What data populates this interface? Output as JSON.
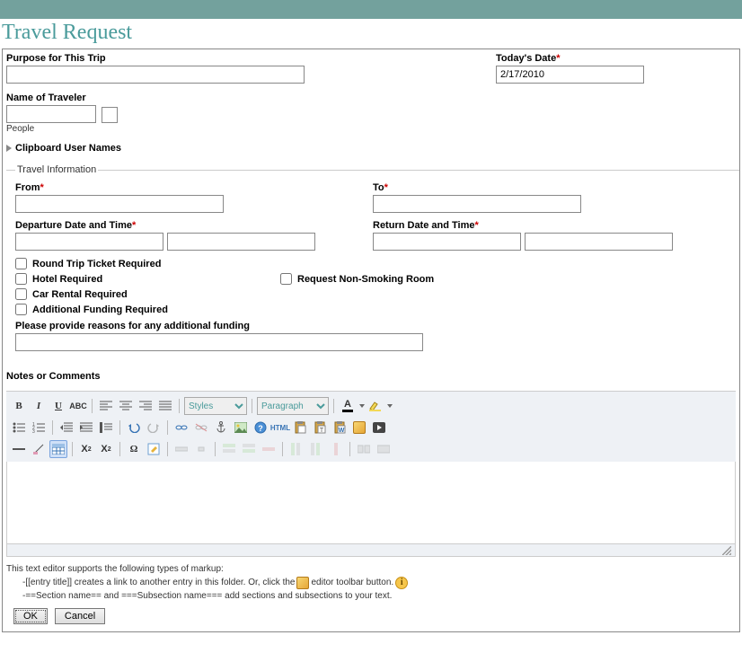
{
  "page": {
    "title": "Travel Request"
  },
  "purpose": {
    "label": "Purpose for This Trip",
    "value": ""
  },
  "today": {
    "label": "Today's Date",
    "value": "2/17/2010"
  },
  "traveler": {
    "label": "Name of Traveler",
    "value": "",
    "helper": "People"
  },
  "clipboard": {
    "label": "Clipboard User Names"
  },
  "travel_info": {
    "legend": "Travel Information",
    "from_label": "From",
    "from_value": "",
    "to_label": "To",
    "to_value": "",
    "dep_label": "Departure Date and Time",
    "dep_date": "",
    "dep_time": "",
    "ret_label": "Return Date and Time",
    "ret_date": "",
    "ret_time": "",
    "round_trip": "Round Trip Ticket Required",
    "hotel": "Hotel Required",
    "nonsmoking": "Request Non-Smoking Room",
    "car": "Car Rental Required",
    "addl_fund": "Additional Funding Required",
    "reasons_label": "Please provide reasons for any additional funding",
    "reasons_value": ""
  },
  "notes": {
    "label": "Notes or Comments"
  },
  "toolbar": {
    "styles_label": "Styles",
    "paragraph_label": "Paragraph",
    "html_label": "HTML"
  },
  "help": {
    "intro": "This text editor supports the following types of markup:",
    "line1a": "-[[entry title]] creates a link to another entry in this folder. Or, click the",
    "line1b": "editor toolbar button.",
    "line2": "-==Section name== and ===Subsection name=== add sections and subsections to your text."
  },
  "buttons": {
    "ok": "OK",
    "cancel": "Cancel"
  }
}
